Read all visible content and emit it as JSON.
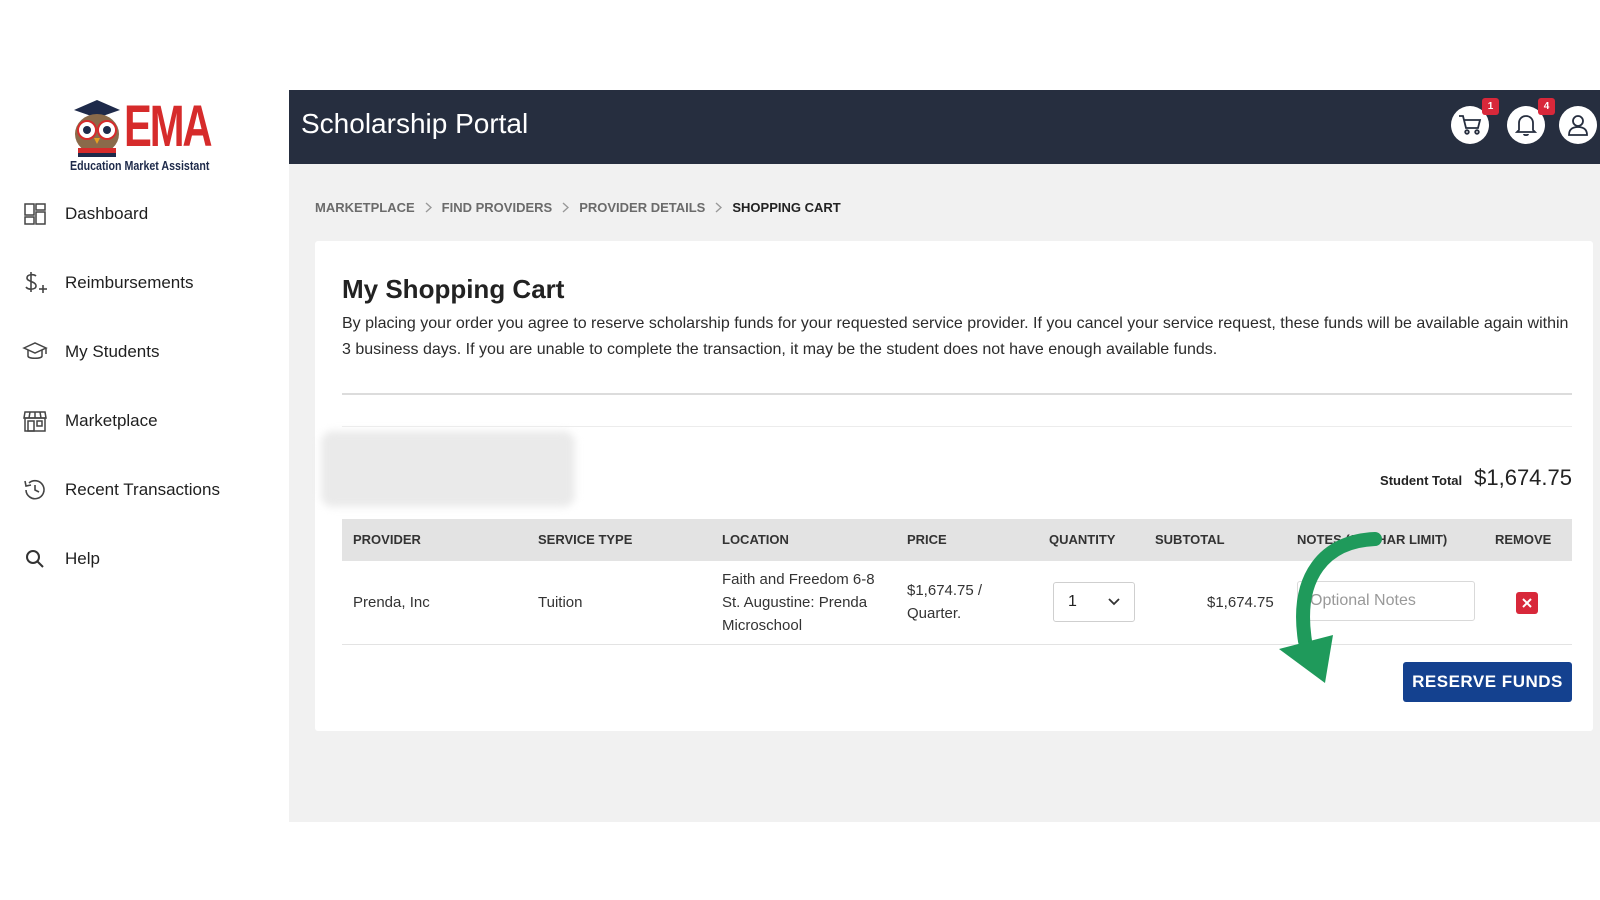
{
  "logo": {
    "text": "EMA",
    "tagline": "Education Market Assistant"
  },
  "sidebar": {
    "items": [
      {
        "label": "Dashboard",
        "icon": "dashboard-icon"
      },
      {
        "label": "Reimbursements",
        "icon": "dollar-plus-icon"
      },
      {
        "label": "My Students",
        "icon": "graduation-cap-icon"
      },
      {
        "label": "Marketplace",
        "icon": "storefront-icon"
      },
      {
        "label": "Recent Transactions",
        "icon": "history-icon"
      },
      {
        "label": "Help",
        "icon": "search-icon"
      }
    ]
  },
  "header": {
    "title": "Scholarship Portal",
    "cart_badge": "1",
    "notifications_badge": "4"
  },
  "breadcrumb": {
    "items": [
      "MARKETPLACE",
      "FIND PROVIDERS",
      "PROVIDER DETAILS",
      "SHOPPING CART"
    ]
  },
  "cart": {
    "title": "My Shopping Cart",
    "description": "By placing your order you agree to reserve scholarship funds for your requested service provider. If you cancel your service request, these funds will be available again within 3 business days. If you are unable to complete the transaction, it may be the student does not have enough available funds.",
    "student_total_label": "Student Total",
    "student_total_value": "$1,674.75",
    "columns": [
      "PROVIDER",
      "SERVICE TYPE",
      "LOCATION",
      "PRICE",
      "QUANTITY",
      "SUBTOTAL",
      "NOTES (25 CHAR LIMIT)",
      "REMOVE"
    ],
    "rows": [
      {
        "provider": "Prenda, Inc",
        "service_type": "Tuition",
        "location": "Faith and Freedom 6-8 St. Augustine: Prenda Microschool",
        "price": "$1,674.75 / Quarter.",
        "quantity": "1",
        "subtotal": "$1,674.75",
        "notes_placeholder": "Optional Notes"
      }
    ],
    "reserve_label": "RESERVE FUNDS"
  },
  "colors": {
    "header_bg": "#262e3f",
    "accent_button": "#14418f",
    "remove_red": "#d8283a",
    "arrow_green": "#1f9a5b",
    "logo_red": "#d62b2b"
  }
}
